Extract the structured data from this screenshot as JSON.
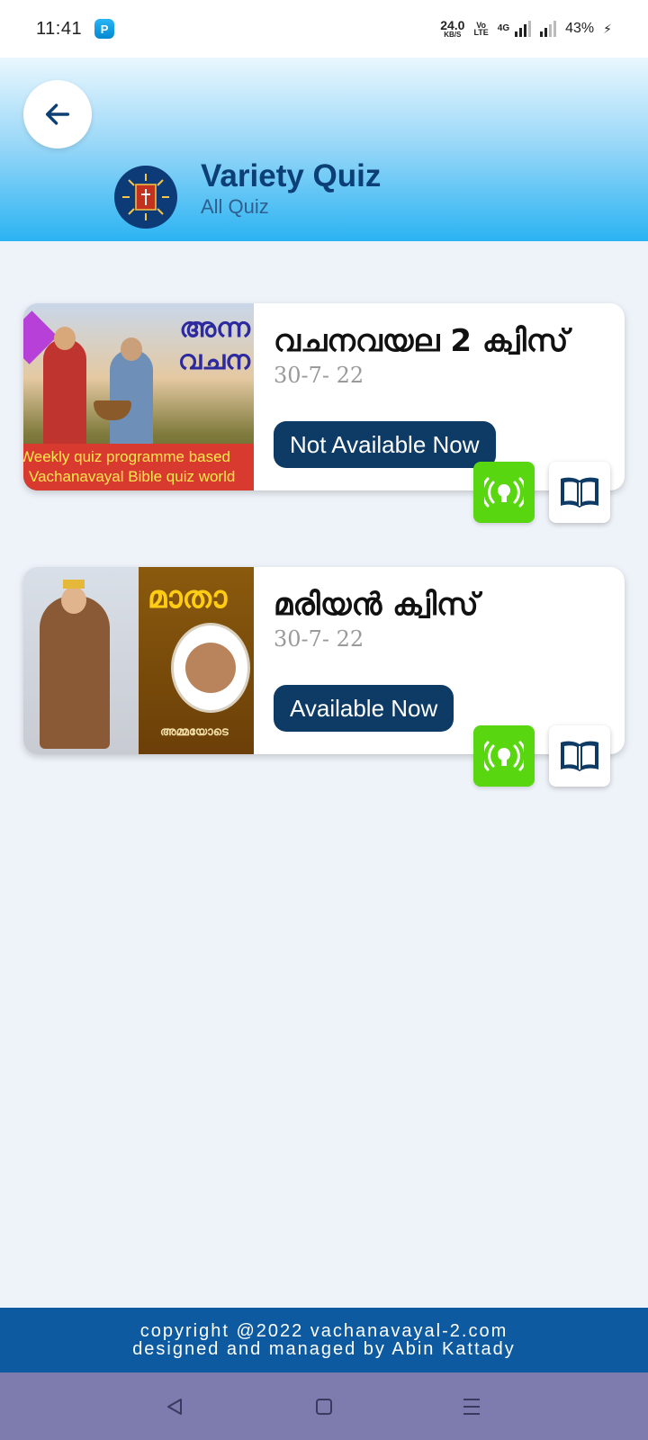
{
  "status_bar": {
    "time": "11:41",
    "net_speed_value": "24.0",
    "net_speed_unit": "KB/S",
    "volte_top": "Vo",
    "volte_bottom": "LTE",
    "network_type": "4G",
    "battery": "43%"
  },
  "header": {
    "title": "Variety Quiz",
    "subtitle": "All Quiz",
    "back_icon": "arrow-left-icon",
    "logo_icon": "cross-logo-icon"
  },
  "quizzes": [
    {
      "title": "വചനവയല 2  ക്വിസ്",
      "date": "30-7- 22",
      "status_label": "Not Available Now",
      "image": {
        "overlay_text_line1": "അന്ന",
        "overlay_text_line2": "വചന",
        "banner_line1": "Weekly quiz programme based",
        "banner_line2": "Vachanavayal Bible quiz world"
      }
    },
    {
      "title": "മരിയൻ ക്വിസ്",
      "date": "30-7- 22",
      "status_label": "Available Now",
      "image": {
        "overlay_text_line1": "മാതാ",
        "overlay_text_line2": "അമ്മയോടെ"
      }
    }
  ],
  "footer": {
    "line1": "copyright @2022 vachanavayal-2.com",
    "line2": "designed and managed by Abin Kattady"
  },
  "colors": {
    "primary": "#0d3b66",
    "live_green": "#58d60f",
    "footer_blue": "#0d5aa0",
    "nav_bar": "#7e7bae"
  }
}
